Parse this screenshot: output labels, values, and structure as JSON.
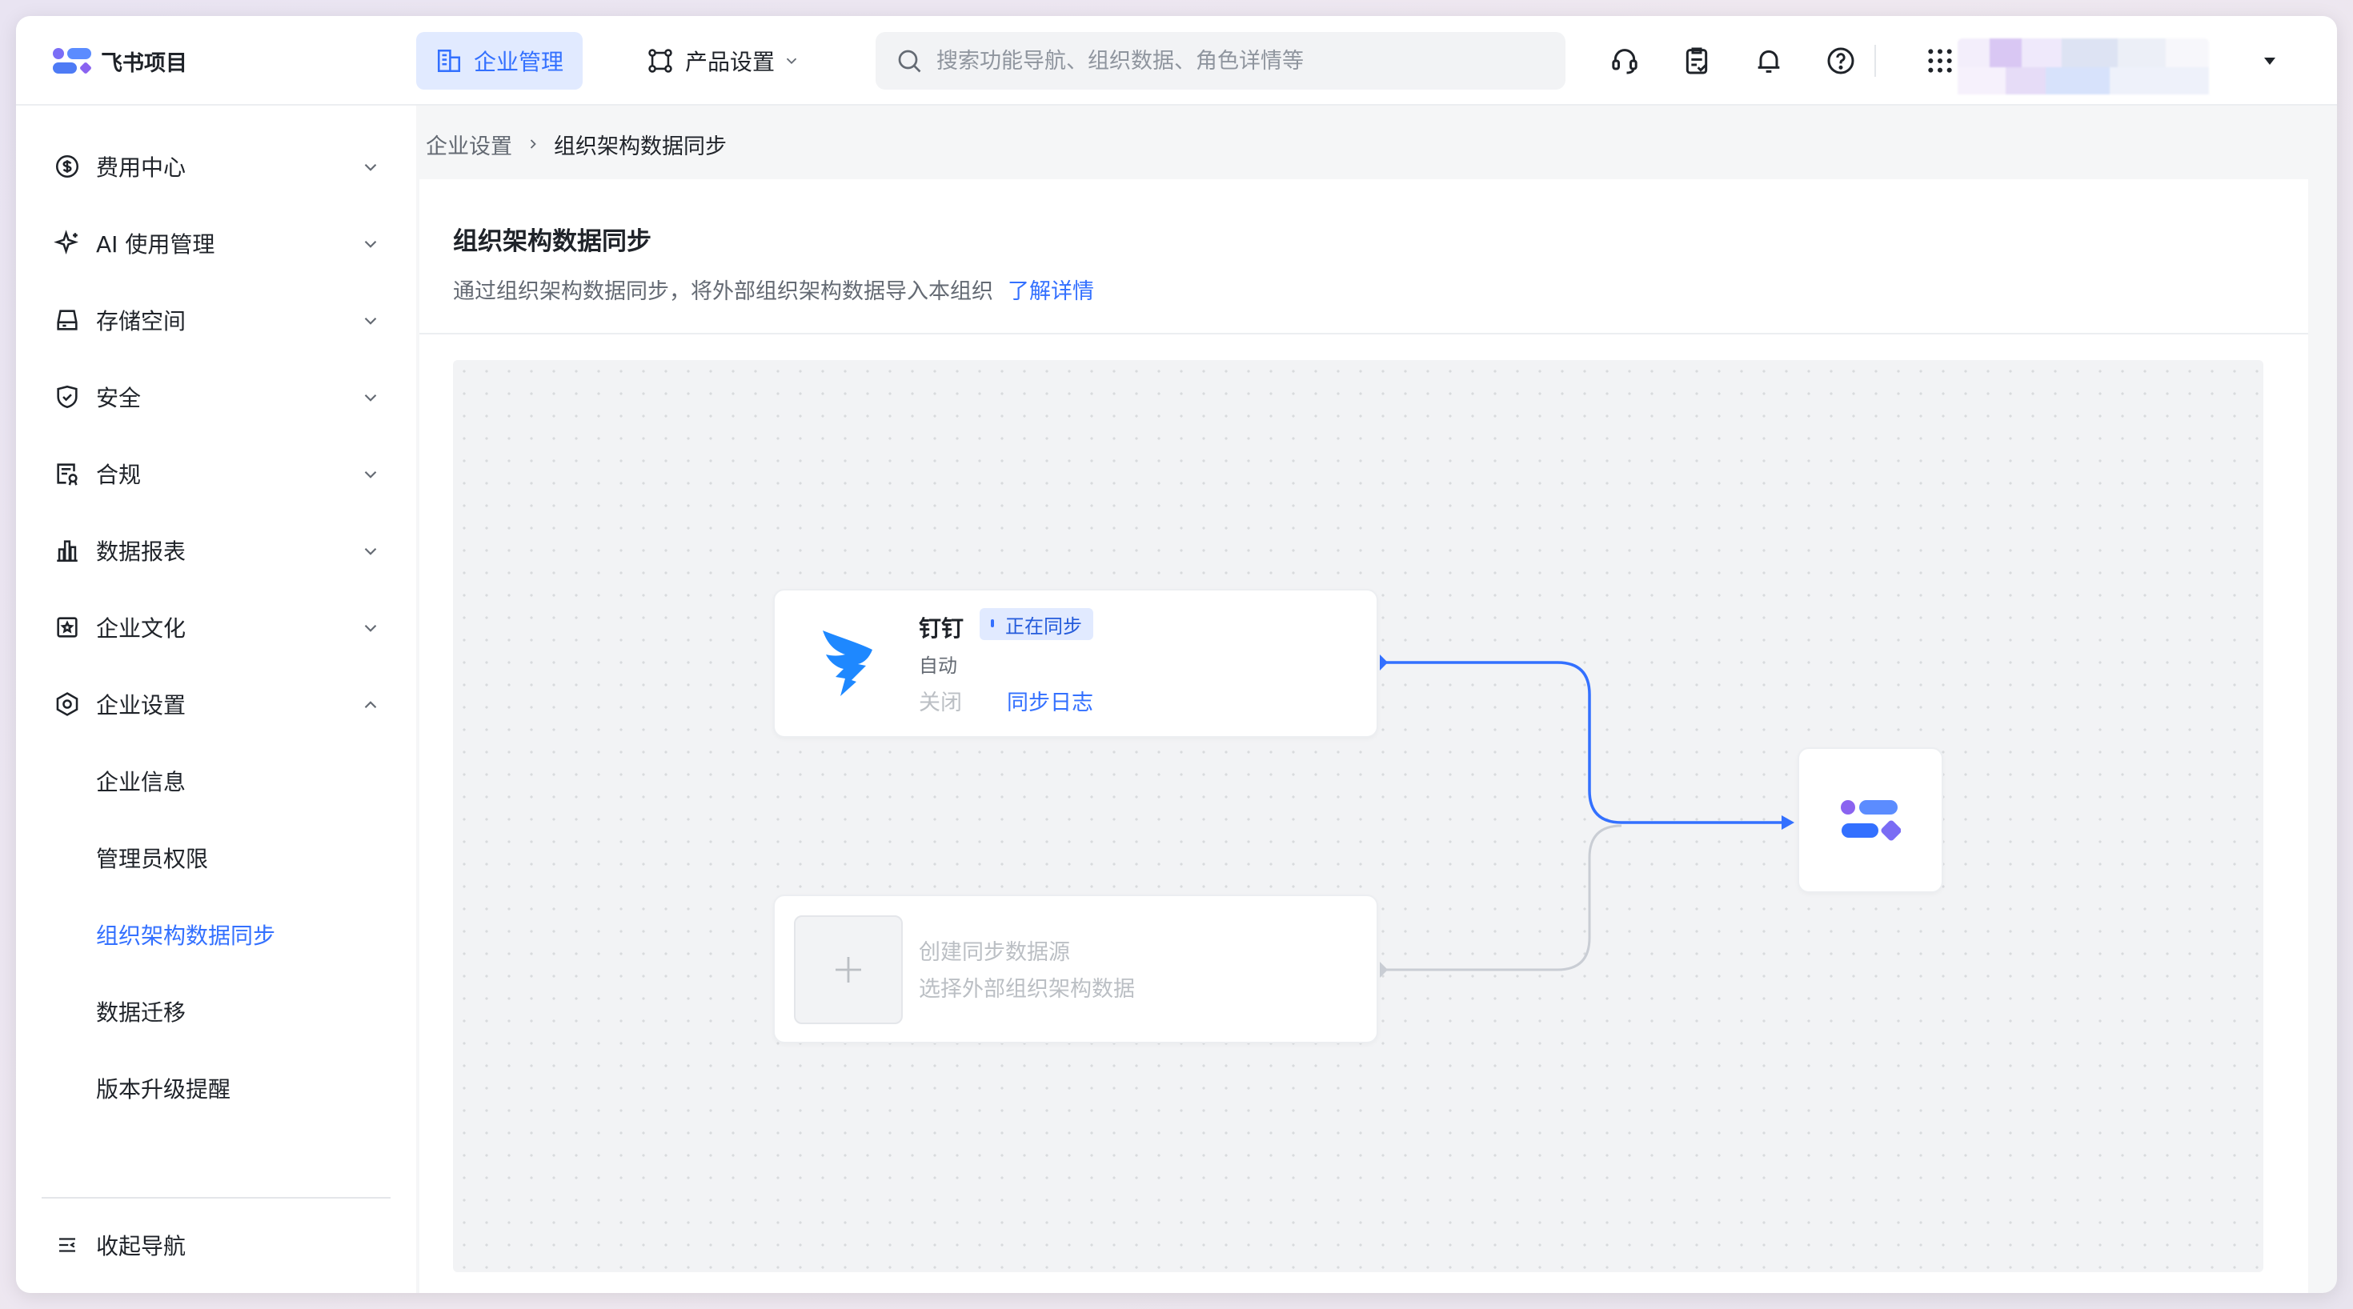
{
  "app": {
    "name": "飞书项目"
  },
  "topnav": {
    "enterprise_label": "企业管理",
    "product_label": "产品设置",
    "search_placeholder": "搜索功能导航、组织数据、角色详情等"
  },
  "sidebar": {
    "items": [
      {
        "label": "费用中心",
        "icon": "dollar-circle-icon"
      },
      {
        "label": "AI 使用管理",
        "icon": "sparkle-icon"
      },
      {
        "label": "存储空间",
        "icon": "storage-icon"
      },
      {
        "label": "安全",
        "icon": "shield-icon"
      },
      {
        "label": "合规",
        "icon": "compliance-doc-icon"
      },
      {
        "label": "数据报表",
        "icon": "bar-chart-icon"
      },
      {
        "label": "企业文化",
        "icon": "culture-star-icon"
      },
      {
        "label": "企业设置",
        "icon": "settings-hexagon-icon"
      }
    ],
    "sub_items": [
      {
        "label": "企业信息"
      },
      {
        "label": "管理员权限"
      },
      {
        "label": "组织架构数据同步"
      },
      {
        "label": "数据迁移"
      },
      {
        "label": "版本升级提醒"
      }
    ],
    "collapse_label": "收起导航"
  },
  "breadcrumb": {
    "parent": "企业设置",
    "current": "组织架构数据同步"
  },
  "panel": {
    "title": "组织架构数据同步",
    "description": "通过组织架构数据同步，将外部组织架构数据导入本组织",
    "learn_more": "了解详情"
  },
  "sync_source": {
    "name": "钉钉",
    "status": "正在同步",
    "mode": "自动",
    "close_label": "关闭",
    "log_label": "同步日志"
  },
  "add_source": {
    "title": "创建同步数据源",
    "subtitle": "选择外部组织架构数据"
  },
  "colors": {
    "accent": "#3370ff",
    "flow_active": "#3370ff",
    "flow_inactive": "#c9cdd4"
  }
}
